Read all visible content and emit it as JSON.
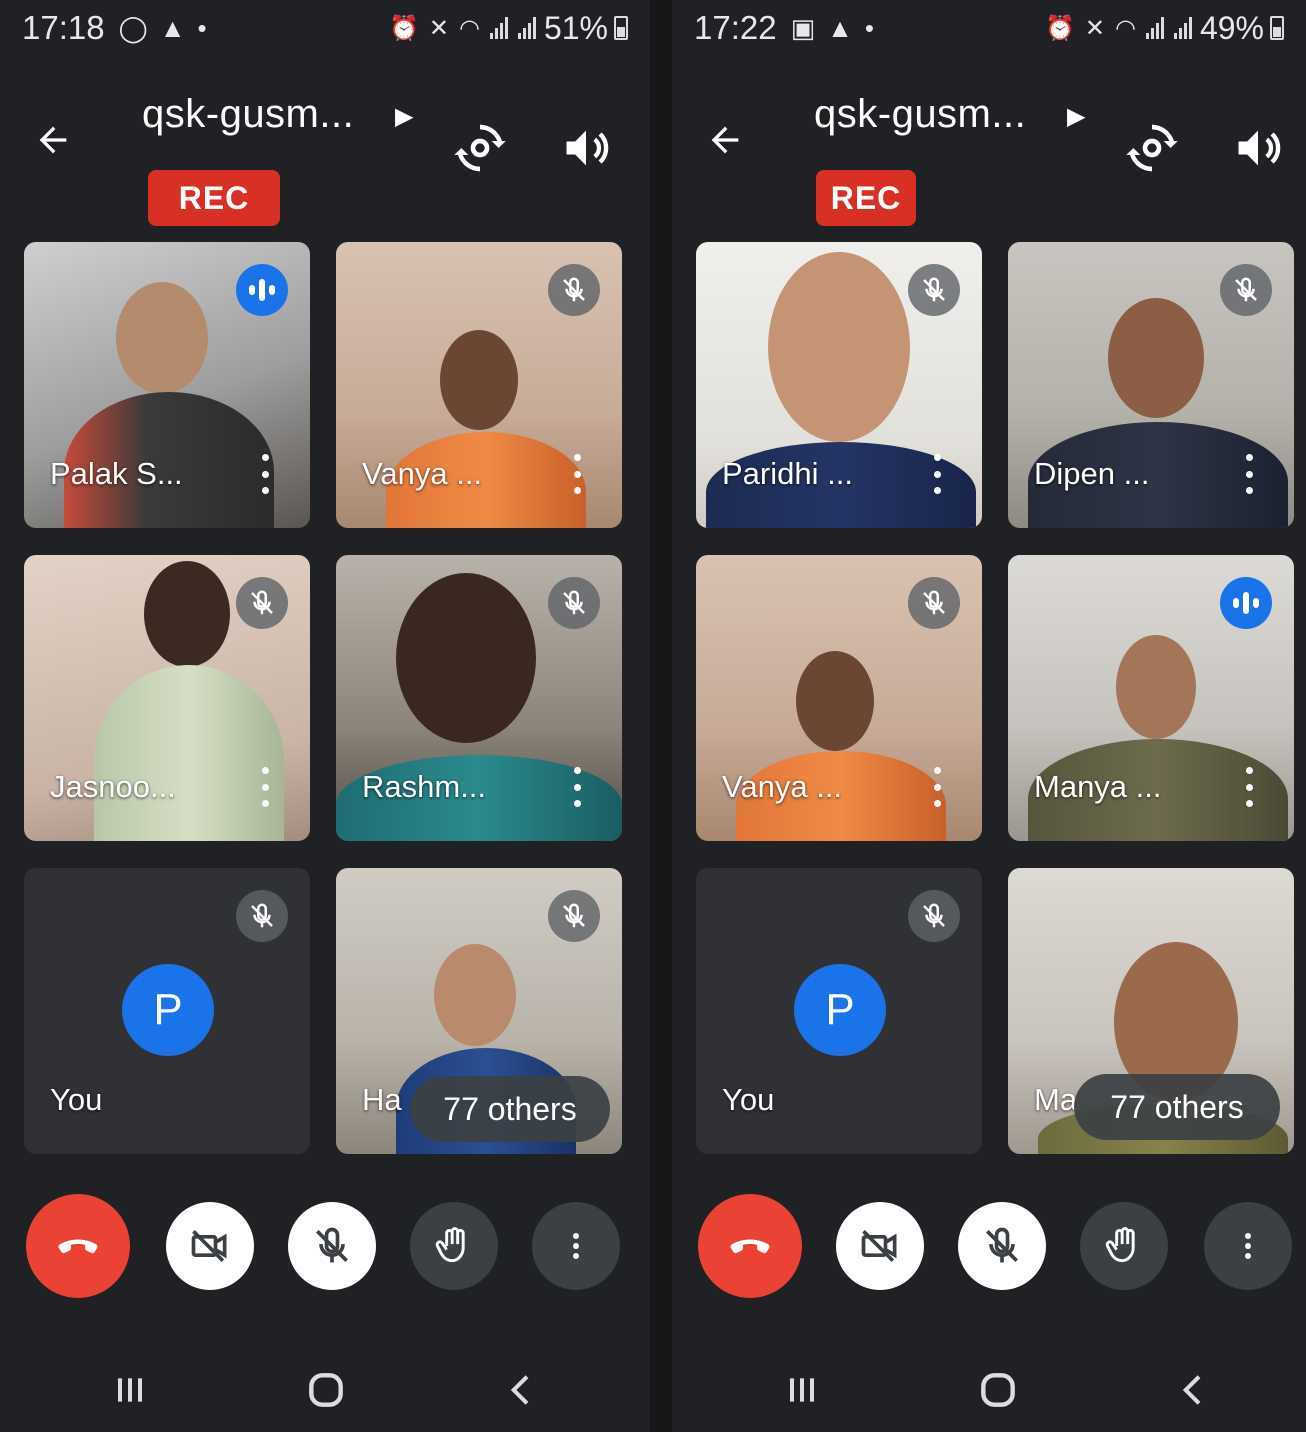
{
  "screens": [
    {
      "status": {
        "time": "17:18",
        "battery": "51%"
      },
      "meeting_title": "qsk-gusm...",
      "rec_label": "REC",
      "tiles": [
        {
          "name": "Palak S...",
          "state": "speaking"
        },
        {
          "name": "Vanya ...",
          "state": "muted"
        },
        {
          "name": "Jasnoo...",
          "state": "muted"
        },
        {
          "name": "Rashm...",
          "state": "muted"
        },
        {
          "name": "You",
          "state": "muted",
          "avatar_letter": "P"
        },
        {
          "name": "Ha",
          "state": "muted",
          "others_label": "77 others"
        }
      ]
    },
    {
      "status": {
        "time": "17:22",
        "battery": "49%"
      },
      "meeting_title": "qsk-gusm...",
      "rec_label": "REC",
      "tiles": [
        {
          "name": "Paridhi ...",
          "state": "muted"
        },
        {
          "name": "Dipen ...",
          "state": "muted"
        },
        {
          "name": "Vanya ...",
          "state": "muted"
        },
        {
          "name": "Manya ...",
          "state": "speaking"
        },
        {
          "name": "You",
          "state": "muted",
          "avatar_letter": "P"
        },
        {
          "name": "Ma",
          "state": "muted",
          "others_label": "77 others"
        }
      ]
    }
  ],
  "colors": {
    "background": "#202124",
    "rec": "#d93025",
    "end_call": "#ea4335",
    "accent": "#1a73e8",
    "tile": "#3c4043"
  },
  "icons": {
    "back": "arrow-left-icon",
    "switch_camera": "switch-camera-icon",
    "speaker": "speaker-icon",
    "mic_off": "mic-off-icon",
    "speaking": "audio-level-icon",
    "end_call": "end-call-icon",
    "camera_off": "camera-off-icon",
    "raise_hand": "hand-icon",
    "more": "more-vert-icon"
  }
}
